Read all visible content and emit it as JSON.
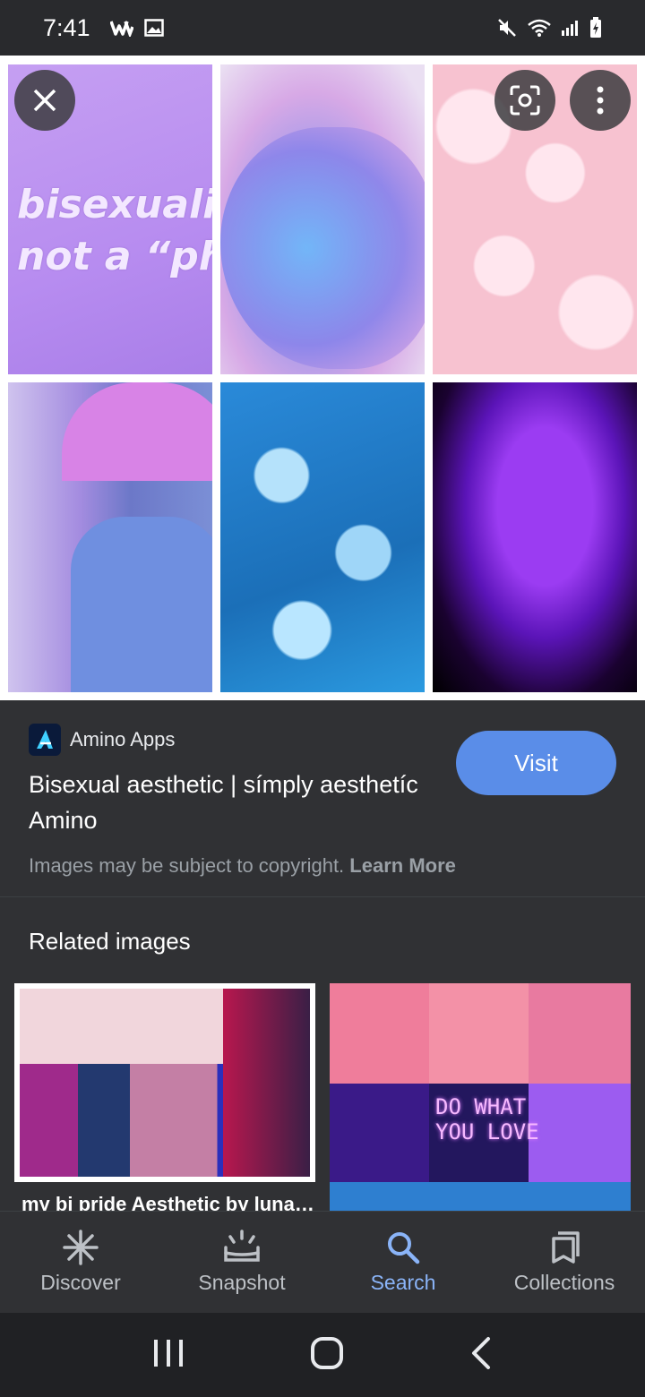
{
  "status_bar": {
    "time": "7:41"
  },
  "image_grid": {
    "tile1_text": "bisexuality\nnot a “pha"
  },
  "result": {
    "source_name": "Amino Apps",
    "title": "Bisexual aesthetic | símply aesthetíc Amino",
    "visit_label": "Visit",
    "copyright_text": "Images may be subject to copyright.",
    "learn_more": "Learn More"
  },
  "related": {
    "heading": "Related images",
    "items": [
      {
        "caption": "my bi pride Aesthetic by lunat…"
      },
      {
        "caption": ""
      }
    ],
    "neon_text": "DO WHAT\nYOU LOVE"
  },
  "bottom_nav": {
    "items": [
      {
        "label": "Discover",
        "icon": "asterisk-icon"
      },
      {
        "label": "Snapshot",
        "icon": "snapshot-icon"
      },
      {
        "label": "Search",
        "icon": "search-icon",
        "active": true
      },
      {
        "label": "Collections",
        "icon": "collections-icon"
      }
    ]
  },
  "colors": {
    "accent": "#8ab4f8",
    "visit_button": "#5a8de8",
    "background": "#303134"
  }
}
